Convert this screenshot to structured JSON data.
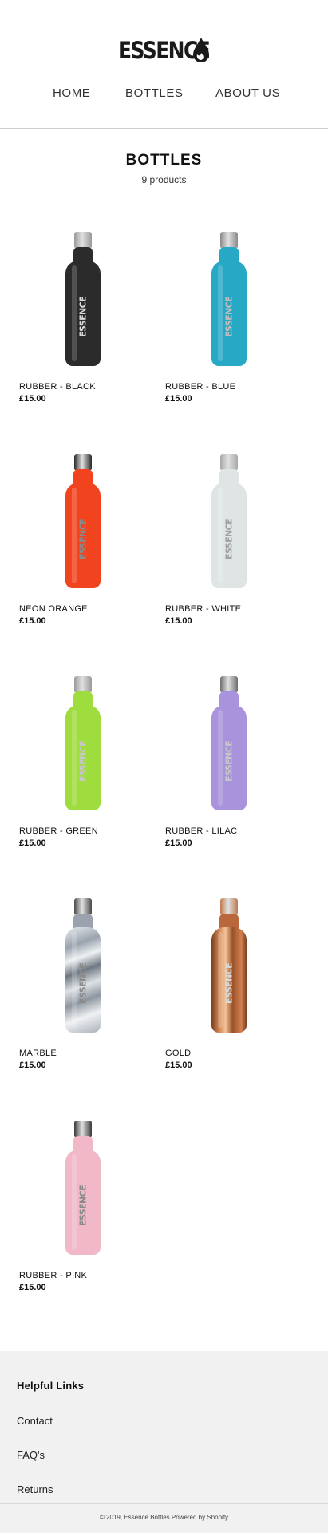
{
  "header": {
    "logo_text": "ESSENCE",
    "nav": [
      {
        "label": "HOME"
      },
      {
        "label": "BOTTLES"
      },
      {
        "label": "ABOUT US"
      }
    ]
  },
  "collection": {
    "title": "BOTTLES",
    "count": "9 products"
  },
  "products": [
    {
      "name": "RUBBER - BLACK",
      "price": "£15.00",
      "color": "#2b2b2b",
      "cap": "#9a9a9a",
      "brand_color": "#d8d8d8"
    },
    {
      "name": "RUBBER - BLUE",
      "price": "£15.00",
      "color": "#27a9c6",
      "cap": "#8a8a8a",
      "brand_color": "#bfbfbf"
    },
    {
      "name": "NEON ORANGE",
      "price": "£15.00",
      "color": "#f2431f",
      "cap": "#2a2a2a",
      "brand_color": "#8a8a8a"
    },
    {
      "name": "RUBBER - WHITE",
      "price": "£15.00",
      "color": "#dfe5e4",
      "cap": "#a8a8a8",
      "brand_color": "#a0a0a0"
    },
    {
      "name": "RUBBER - GREEN",
      "price": "£15.00",
      "color": "#9fdc3e",
      "cap": "#9a9a9a",
      "brand_color": "#c8c8c8"
    },
    {
      "name": "RUBBER - LILAC",
      "price": "£15.00",
      "color": "#a893dc",
      "cap": "#6e6e6e",
      "brand_color": "#c8c8c8"
    },
    {
      "name": "MARBLE",
      "price": "£15.00",
      "color": "#c9cfd6",
      "cap": "#4a4a4a",
      "brand_color": "#8a8a8a"
    },
    {
      "name": "GOLD",
      "price": "£15.00",
      "color": "#b8683a",
      "cap": "#c07a4c",
      "brand_color": "#d9d9d9"
    },
    {
      "name": "RUBBER - PINK",
      "price": "£15.00",
      "color": "#f1b9c7",
      "cap": "#3a3a3a",
      "brand_color": "#8a8a8a"
    }
  ],
  "footer": {
    "heading": "Helpful Links",
    "links": [
      {
        "label": "Contact"
      },
      {
        "label": "FAQ's"
      },
      {
        "label": "Returns"
      }
    ],
    "copyright": "© 2019, Essence Bottles Powered by Shopify"
  }
}
